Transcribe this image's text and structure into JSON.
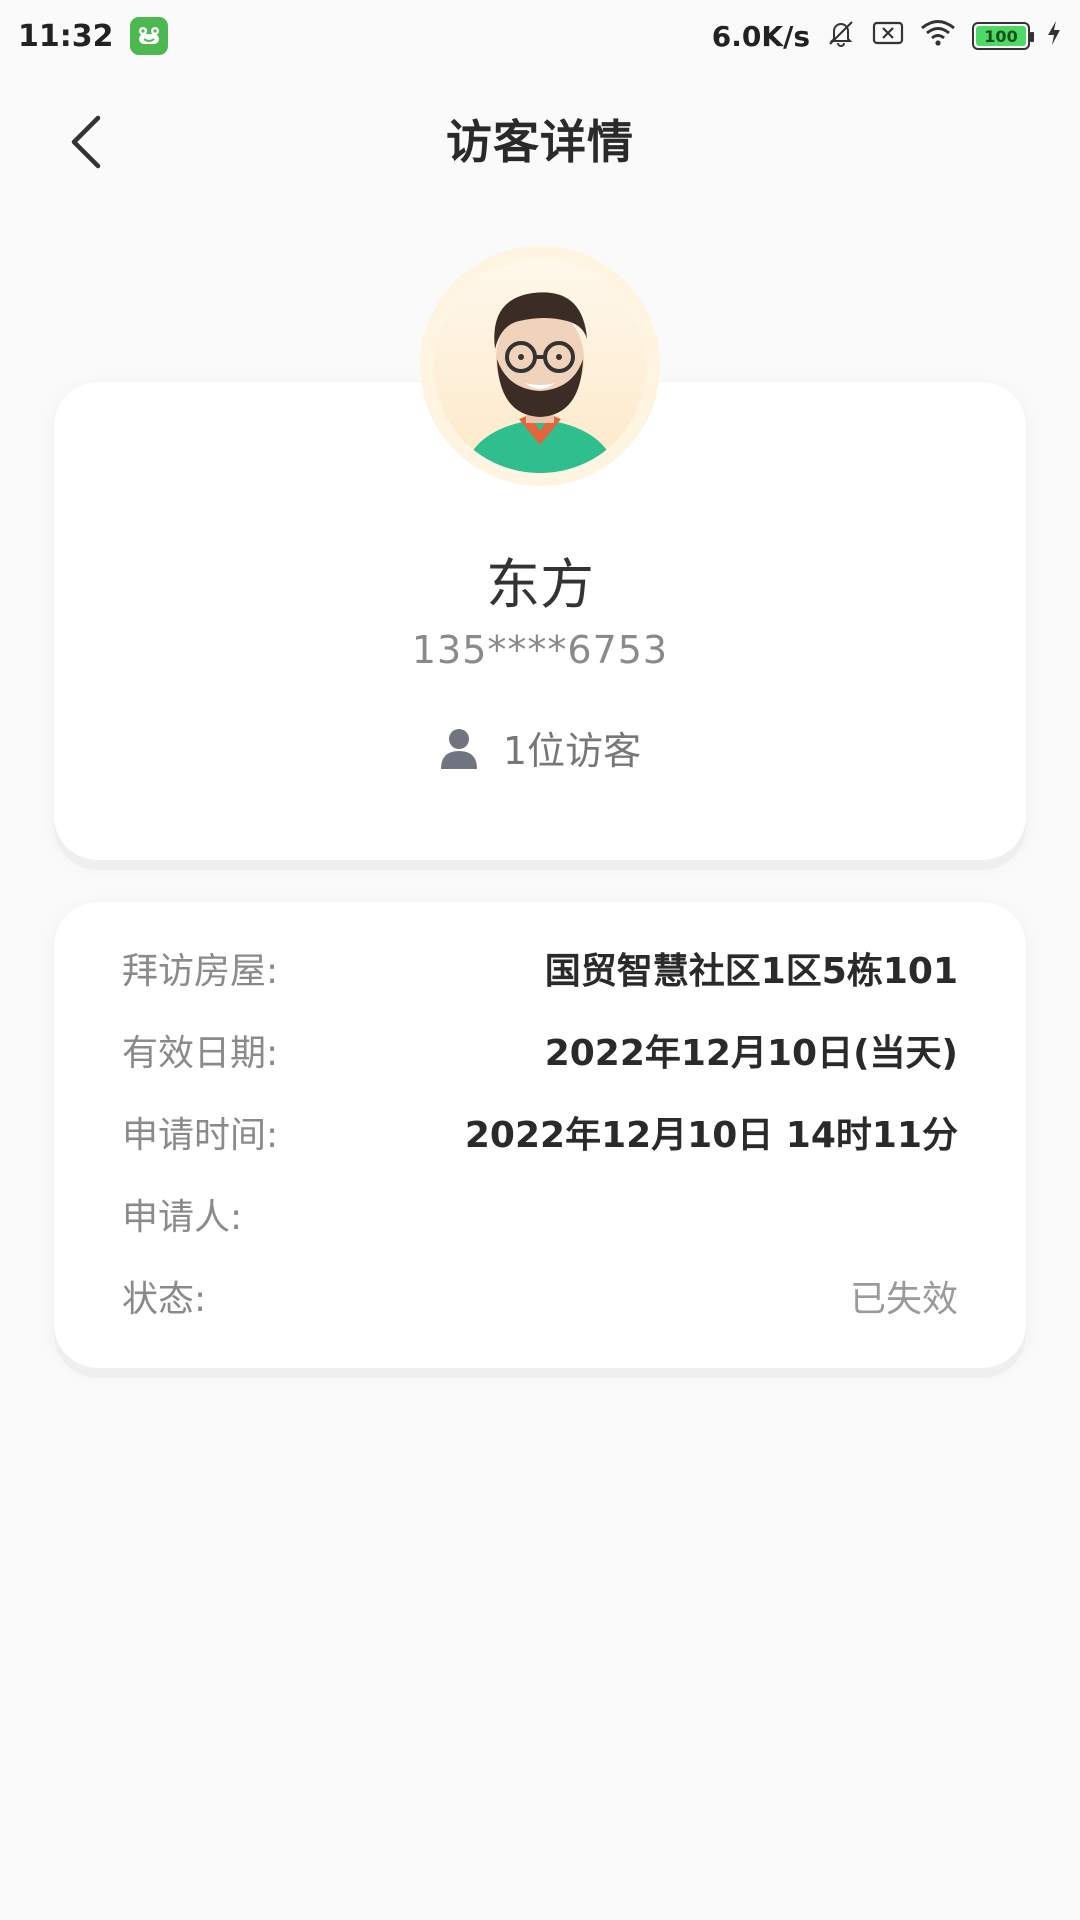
{
  "status_bar": {
    "time": "11:32",
    "net_speed": "6.0K/s",
    "battery": "100"
  },
  "header": {
    "title": "访客详情"
  },
  "visitor": {
    "name": "东方",
    "phone": "135****6753",
    "count": "1位访客"
  },
  "details": {
    "rows": [
      {
        "label": "拜访房屋:",
        "value": "国贸智慧社区1区5栋101"
      },
      {
        "label": "有效日期:",
        "value": "2022年12月10日(当天)"
      },
      {
        "label": "申请时间:",
        "value": "2022年12月10日 14时11分"
      },
      {
        "label": "申请人:",
        "value": ""
      },
      {
        "label": "状态:",
        "value": "已失效"
      }
    ]
  },
  "colors": {
    "background": "#fafafa",
    "card": "#ffffff",
    "label": "#8a8a8a",
    "value": "#2a2a2a",
    "status_invalid": "#9a9a9a",
    "avatar_ring": "#fdf0d9"
  },
  "icons": {
    "back": "chevron-left-icon",
    "person": "person-icon",
    "app": "frog-app-icon",
    "mute": "bell-off-icon",
    "sim": "no-sim-icon",
    "wifi": "wifi-icon",
    "charging": "lightning-icon"
  }
}
